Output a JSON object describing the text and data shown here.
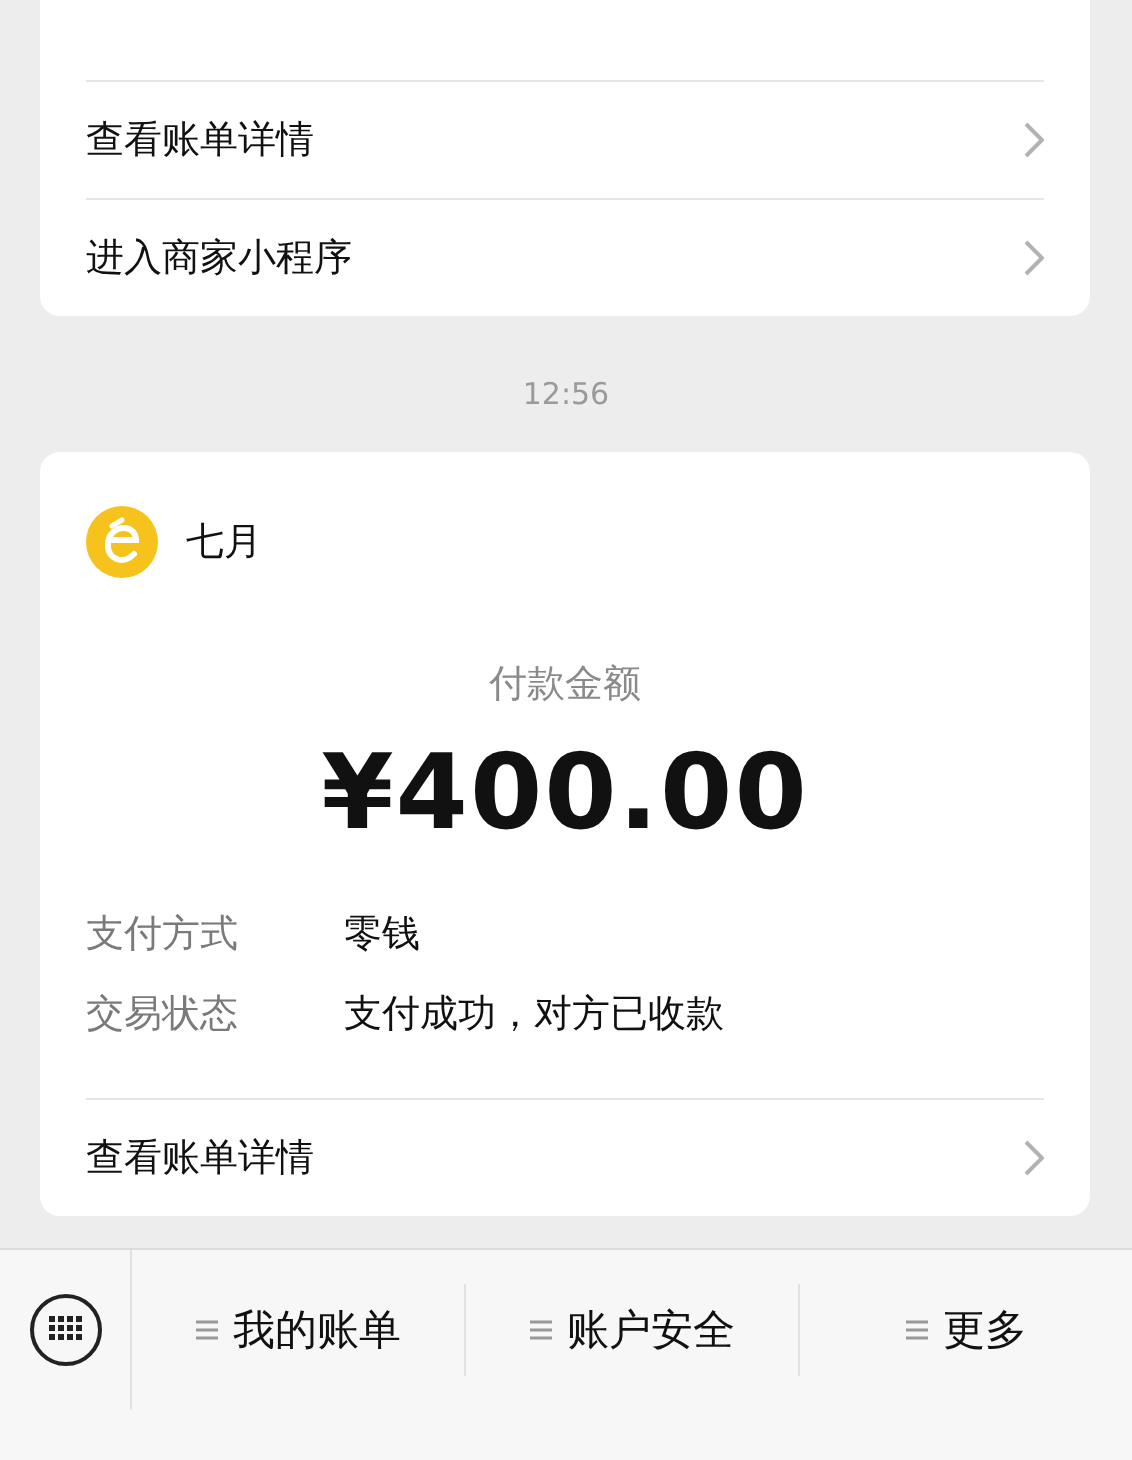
{
  "previous_card": {
    "links": [
      {
        "label": "查看账单详情"
      },
      {
        "label": "进入商家小程序"
      }
    ]
  },
  "timestamp": "12:56",
  "payment_card": {
    "merchant": "七月",
    "amount_label": "付款金额",
    "amount": "¥400.00",
    "details": [
      {
        "label": "支付方式",
        "value": "零钱"
      },
      {
        "label": "交易状态",
        "value": "支付成功，对方已收款"
      }
    ],
    "links": [
      {
        "label": "查看账单详情"
      }
    ]
  },
  "bottom_menu": {
    "items": [
      {
        "label": "我的账单"
      },
      {
        "label": "账户安全"
      },
      {
        "label": "更多"
      }
    ]
  }
}
